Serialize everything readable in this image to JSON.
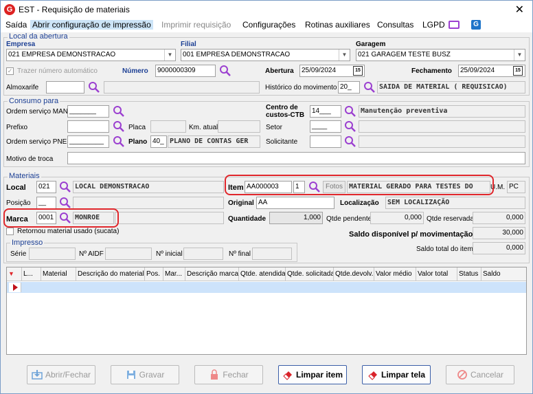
{
  "window": {
    "title": "EST - Requisição de materiais",
    "close": "✕"
  },
  "menu": [
    "Saída",
    "Abrir configuração de impressão",
    "Imprimir requisição",
    "Configurações",
    "Rotinas auxiliares",
    "Consultas",
    "LGPD"
  ],
  "local_abertura": {
    "title": "Local da abertura",
    "empresa_label": "Empresa",
    "empresa_value": "021 EMPRESA DEMONSTRACAO",
    "filial_label": "Filial",
    "filial_value": "001 EMPRESA DEMONSTRACAO",
    "garagem_label": "Garagem",
    "garagem_value": "021 GARAGEM TESTE BUSZ",
    "trazer_label": "Trazer número automático",
    "numero_label": "Número",
    "numero_value": "9000000309",
    "abertura_label": "Abertura",
    "abertura_value": "25/09/2024",
    "fechamento_label": "Fechamento",
    "fechamento_value": "25/09/2024",
    "almoxarife_label": "Almoxarife",
    "historico_label": "Histórico do movimento",
    "historico_code": "20_",
    "historico_value": "SAIDA DE MATERIAL ( REQUISICAO)"
  },
  "consumo": {
    "title": "Consumo para",
    "ordem_man_label": "Ordem serviço MAN",
    "ordem_man_value": "_______",
    "centro_label": "Centro de custos-CTB",
    "centro_code": "14___",
    "centro_value": "Manutenção preventiva",
    "prefixo_label": "Prefixo",
    "placa_label": "Placa",
    "km_label": "Km. atual",
    "setor_label": "Setor",
    "setor_value": "____",
    "ordem_pne_label": "Ordem serviço PNE",
    "ordem_pne_value": "_________",
    "plano_label": "Plano",
    "plano_code": "40_",
    "plano_value": "PLANO DE CONTAS GER",
    "solicitante_label": "Solicitante",
    "motivo_label": "Motivo de troca"
  },
  "materiais": {
    "title": "Materiais",
    "local_label": "Local",
    "local_code": "021",
    "local_value": "LOCAL DEMONSTRACAO",
    "item_label": "Item",
    "item_code": "AA000003",
    "item_qty": "1",
    "fotos_label": "Fotos",
    "item_value": "MATERIAL GERADO PARA TESTES DO",
    "um_label": "U.M.",
    "um_value": "PC",
    "posicao_label": "Posição",
    "posicao_value": "__",
    "original_label": "Original",
    "original_value": "AA",
    "localizacao_label": "Localização",
    "localizacao_value": "SEM LOCALIZAÇÃO",
    "marca_label": "Marca",
    "marca_code": "0001",
    "marca_value": "MONROE",
    "quantidade_label": "Quantidade",
    "quantidade_value": "1,000",
    "qtde_pendente_label": "Qtde pendente",
    "qtde_pendente_value": "0,000",
    "qtde_reservada_label": "Qtde reservada",
    "qtde_reservada_value": "0,000",
    "retornou_label": "Retornou material usado (sucata)",
    "saldo_disp_label": "Saldo disponível p/ movimentação",
    "saldo_disp_value": "30,000",
    "saldo_total_label": "Saldo total do item",
    "saldo_total_value": "0,000"
  },
  "impresso": {
    "title": "Impresso",
    "serie_label": "Série",
    "aidf_label": "Nº AIDF",
    "inicial_label": "Nº inicial",
    "final_label": "Nº final"
  },
  "grid_columns": [
    "L...",
    "Material",
    "Descrição do material",
    "Pos.",
    "Mar...",
    "Descrição marca",
    "Qtde. atendida",
    "Qtde. solicitada",
    "Qtde.devolv.",
    "Valor médio",
    "Valor total",
    "Status",
    "Saldo"
  ],
  "buttons": {
    "abrir_fechar": "Abrir/Fechar",
    "gravar": "Gravar",
    "fechar": "Fechar",
    "limpar_item": "Limpar item",
    "limpar_tela": "Limpar tela",
    "cancelar": "Cancelar"
  },
  "colors": {
    "accent": "#1c3f94",
    "highlight": "#e0262b",
    "icon": "#9b3fd0"
  }
}
